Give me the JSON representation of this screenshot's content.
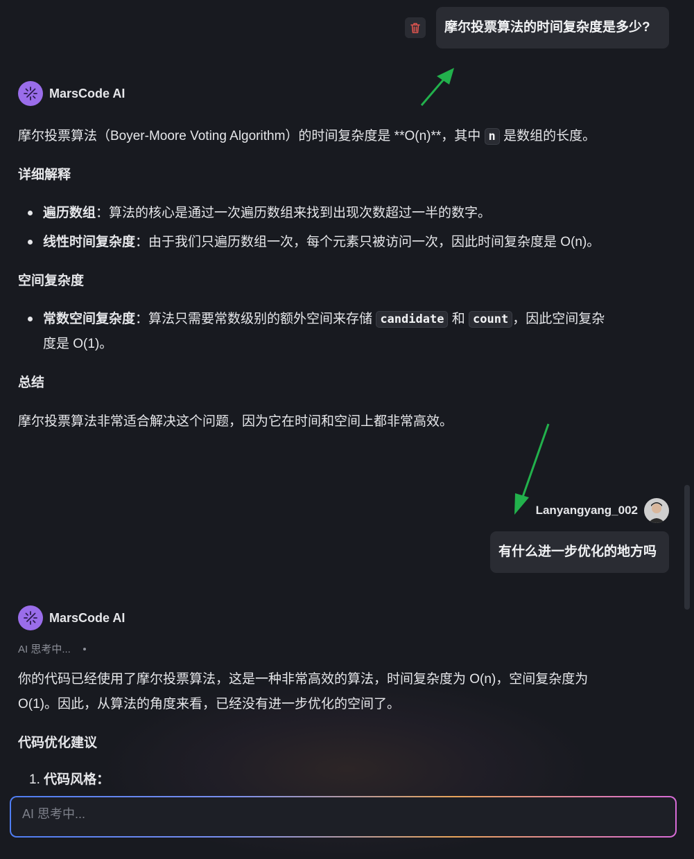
{
  "conversation": {
    "q1": "摩尔投票算法的时间复杂度是多少?",
    "ai_name": "MarsCode AI",
    "a1": {
      "p1_a": "摩尔投票算法（Boyer-Moore Voting Algorithm）的时间复杂度是 **O(n)**，其中",
      "p1_code": "n",
      "p1_b": "是数组的长度。",
      "h1": "详细解释",
      "li1_b": "遍历数组",
      "li1_t": "：算法的核心是通过一次遍历数组来找到出现次数超过一半的数字。",
      "li2_b": "线性时间复杂度",
      "li2_t": "：由于我们只遍历数组一次，每个元素只被访问一次，因此时间复杂度是 O(n)。",
      "h2": "空间复杂度",
      "li3_b": "常数空间复杂度",
      "li3_t1": "：算法只需要常数级别的额外空间来存储",
      "li3_code1": "candidate",
      "li3_and": "和",
      "li3_code2": "count",
      "li3_t2": "，因此空间复杂",
      "li3_t3": "度是 O(1)。",
      "h3": "总结",
      "p_summary": "摩尔投票算法非常适合解决这个问题，因为它在时间和空间上都非常高效。"
    },
    "user_name": "Lanyangyang_002",
    "q2": "有什么进一步优化的地方吗",
    "a2": {
      "thinking": "AI 思考中...",
      "p1_l1": "你的代码已经使用了摩尔投票算法，这是一种非常高效的算法，时间复杂度为 O(n)，空间复杂度为",
      "p1_l2": "O(1)。因此，从算法的角度来看，已经没有进一步优化的空间了。",
      "h1": "代码优化建议",
      "li1_num": "1.",
      "li1_b": "代码风格："
    }
  },
  "input": {
    "placeholder": "AI 思考中..."
  },
  "icons": {
    "delete": "trash-icon",
    "ai_avatar": "sparkle-icon",
    "annotation": "green-arrow"
  },
  "colors": {
    "background": "#181a20",
    "bubble": "#2a2c33",
    "ai_avatar": "#9a6dea",
    "arrow": "#22b14c",
    "trash": "#e0554f"
  }
}
